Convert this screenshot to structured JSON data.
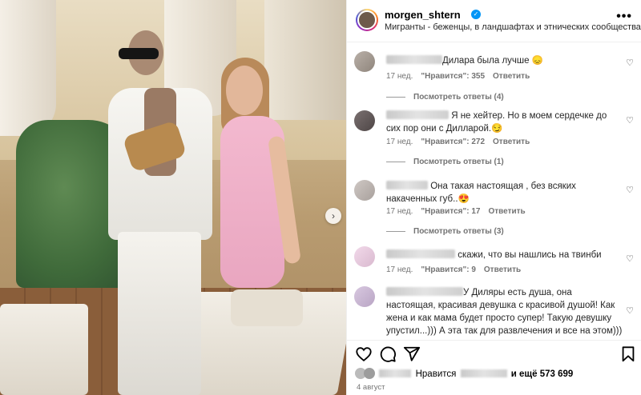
{
  "post": {
    "username": "morgen_shtern",
    "caption": "Мигранты - беженцы, в ландшафтах и этнических сообществах.",
    "more_label": "•••"
  },
  "comments": [
    {
      "text": "Дилара была лучше 😞",
      "time": "17 нед.",
      "likes": "\"Нравится\": 355",
      "reply": "Ответить",
      "view_replies": "Посмотреть ответы (4)"
    },
    {
      "text": "Я не хейтер. Но в моем сердечке до сих пор они с Дилларой.😏",
      "time": "17 нед.",
      "likes": "\"Нравится\": 272",
      "reply": "Ответить",
      "view_replies": "Посмотреть ответы (1)"
    },
    {
      "text": "Она такая настоящая , без всяких накаченных губ..😍",
      "time": "17 нед.",
      "likes": "\"Нравится\": 17",
      "reply": "Ответить",
      "view_replies": "Посмотреть ответы (3)"
    },
    {
      "text": "скажи, что вы нашлись на твинби",
      "time": "17 нед.",
      "likes": "\"Нравится\": 9",
      "reply": "Ответить",
      "view_replies": ""
    },
    {
      "text": "У Диляры есть душа, она настоящая, красивая девушка с красивой душой! Как жена и как мама будет просто супер! Такую девушку упустил...))) А эта так для развлечения и все на этом)))",
      "time": "",
      "likes": "",
      "reply": "",
      "view_replies": ""
    }
  ],
  "likes_bar": {
    "prefix": "Нравится",
    "suffix": "и ещё",
    "count": "573 699"
  },
  "date": "4 август",
  "icons": {
    "heart": "heart-icon",
    "comment": "comment-icon",
    "share": "share-icon",
    "save": "bookmark-icon",
    "verified": "verified-badge-icon",
    "next": "chevron-right-icon"
  },
  "colors": {
    "verified": "#0095f6",
    "muted": "#737373",
    "border": "#efefef"
  }
}
